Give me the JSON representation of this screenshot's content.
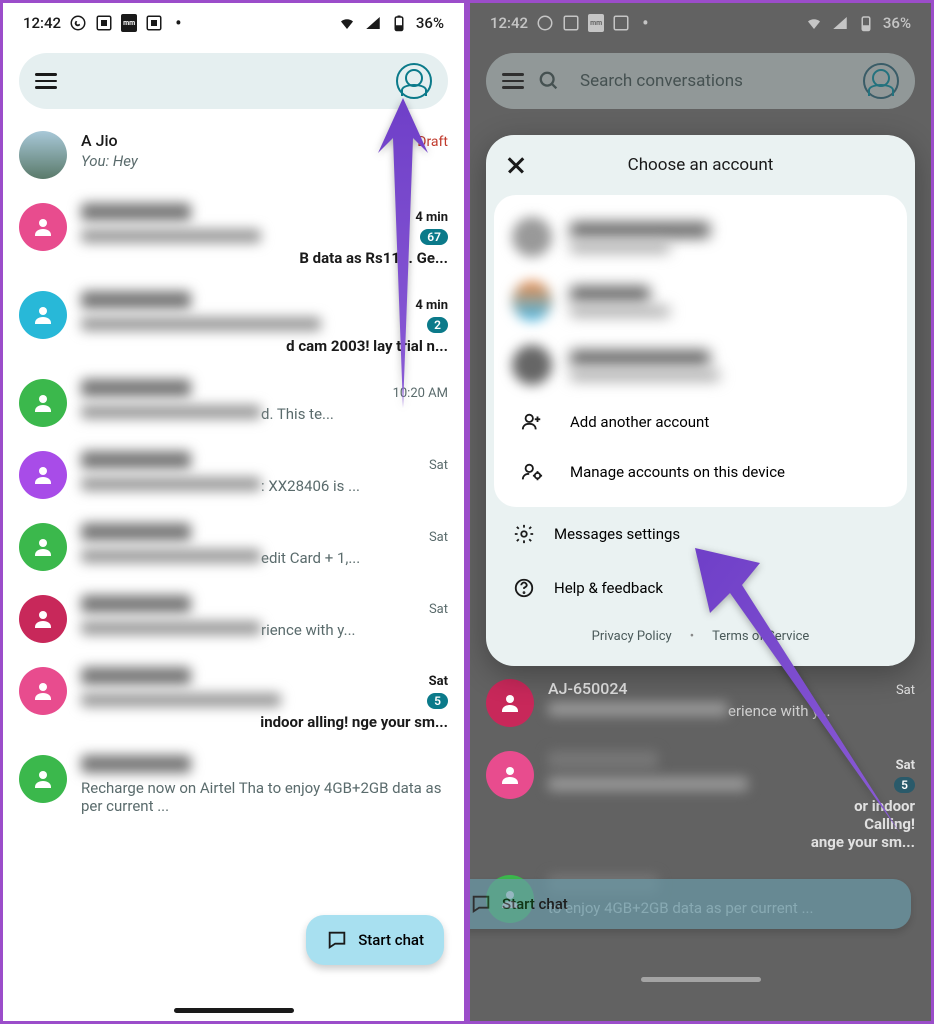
{
  "status": {
    "time": "12:42",
    "battery": "36%"
  },
  "left": {
    "search_placeholder": "",
    "fab": "Start chat",
    "convs": [
      {
        "name": "A Jio",
        "msg": "You: Hey",
        "time": "Draft",
        "avatar": "photo",
        "draft": true,
        "bold": false
      },
      {
        "name": "—",
        "msg": "",
        "time": "4 min",
        "badge": "67",
        "avatar": "#e84c8e",
        "blur": true,
        "bold": true,
        "suffix": "B data as Rs118. Ge..."
      },
      {
        "name": "—",
        "msg": "",
        "time": "4 min",
        "badge": "2",
        "avatar": "#28b8d8",
        "blur": true,
        "bold": true,
        "suffix": "d cam 2003! lay trial n..."
      },
      {
        "name": "—",
        "msg": "d. This te...",
        "time": "10:20 AM",
        "avatar": "#3bb84c",
        "blur": true
      },
      {
        "name": "—",
        "msg": ": XX28406 is ...",
        "time": "Sat",
        "avatar": "#a84ce8",
        "blur": true
      },
      {
        "name": "—",
        "msg": "edit Card + 1,...",
        "time": "Sat",
        "avatar": "#3bb84c",
        "blur": true
      },
      {
        "name": "—",
        "msg": "rience with y...",
        "time": "Sat",
        "avatar": "#c8285a",
        "blur": true
      },
      {
        "name": "—",
        "msg": "indoor alling! nge your sm...",
        "time": "Sat",
        "badge": "5",
        "avatar": "#e84c8e",
        "blur": true,
        "bold": true
      },
      {
        "name": "—",
        "msg": "Recharge now on Airtel Tha to enjoy 4GB+2GB data as per current ...",
        "time": "",
        "avatar": "#3bb84c",
        "blur": true
      }
    ]
  },
  "right": {
    "search_placeholder": "Search conversations",
    "fab": "Start chat",
    "sheet_title": "Choose an account",
    "add_account": "Add another account",
    "manage": "Manage accounts on this device",
    "settings": "Messages settings",
    "help": "Help & feedback",
    "privacy": "Privacy Policy",
    "terms": "Terms of Service",
    "conv_name": "AJ-650024",
    "conv_time": "Sat",
    "conv_msg": "erience with y...",
    "conv2_msg1": "or indoor",
    "conv2_msg2": "Calling!",
    "conv2_msg3": "ange your sm...",
    "conv2_time": "Sat",
    "conv2_badge": "5",
    "conv3_msg": "to enjoy 4GB+2GB data as per current ..."
  }
}
